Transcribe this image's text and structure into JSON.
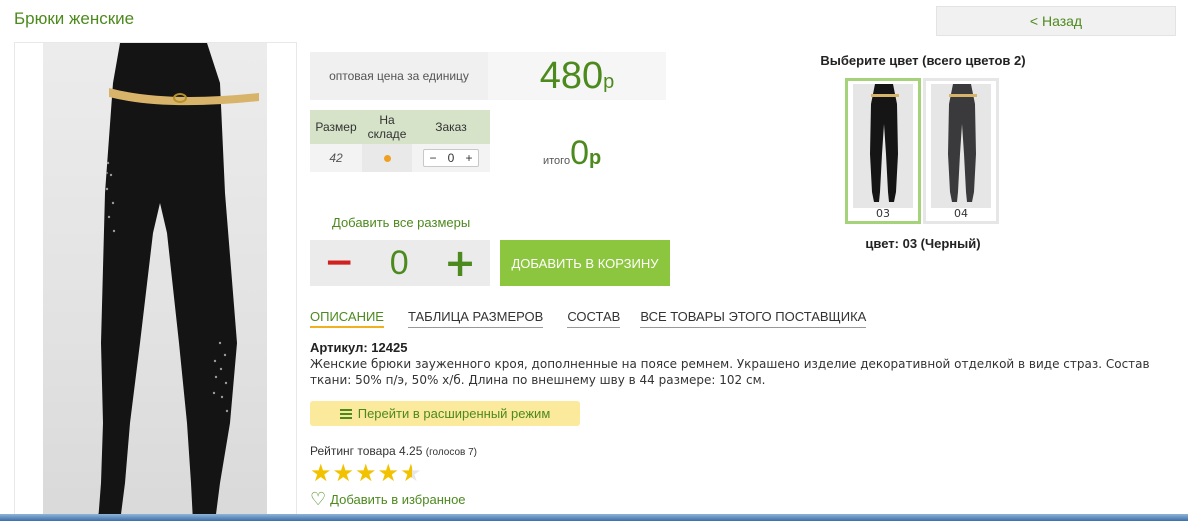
{
  "page": {
    "title": "Брюки женские",
    "back_label": "< Назад"
  },
  "price": {
    "label": "оптовая цена за единицу",
    "value": "480",
    "currency": "р"
  },
  "size_table": {
    "headers": [
      "Размер",
      "На складе",
      "Заказ"
    ],
    "rows": [
      {
        "size": "42",
        "in_stock": true,
        "order_qty": "0"
      }
    ],
    "minus": "−",
    "plus": "+"
  },
  "total": {
    "label": "итого",
    "value": "0",
    "currency": "р"
  },
  "add_all_sizes": "Добавить все размеры",
  "quantity": {
    "minus": "−",
    "value": "0",
    "plus": "+"
  },
  "add_to_cart": "ДОБАВИТЬ В КОРЗИНУ",
  "colors": {
    "title": "Выберите цвет (всего цветов 2)",
    "swatches": [
      {
        "code": "03",
        "selected": true
      },
      {
        "code": "04",
        "selected": false
      }
    ],
    "selected_label": "цвет: 03 (Черный)"
  },
  "tabs": [
    {
      "label": "ОПИСАНИЕ",
      "active": true
    },
    {
      "label": "ТАБЛИЦА РАЗМЕРОВ",
      "active": false
    },
    {
      "label": "СОСТАВ",
      "active": false
    },
    {
      "label": "ВСЕ ТОВАРЫ ЭТОГО ПОСТАВЩИКА",
      "active": false
    }
  ],
  "description": {
    "article": "Артикул: 12425",
    "text": "Женские брюки зауженного кроя, дополненные на поясе ремнем. Украшено изделие декоративной отделкой в виде страз. Состав ткани: 50% п/э, 50% х/б. Длина по внешнему шву в 44 размере: 102 см."
  },
  "extended_mode": {
    "label": "Перейти в расширенный режим",
    "icon": "list-icon"
  },
  "rating": {
    "label": "Рейтинг товара 4.25",
    "votes": "(голосов 7)",
    "value": 4.25,
    "max": 5,
    "star_color": "#f2c200"
  },
  "favorite": {
    "label": "Добавить в избранное",
    "icon": "heart-icon"
  },
  "colors_theme": {
    "accent_green": "#4d8a1e",
    "button_green": "#8cc63f",
    "minus_red": "#d02020",
    "highlight_yellow": "#fbe99c"
  }
}
